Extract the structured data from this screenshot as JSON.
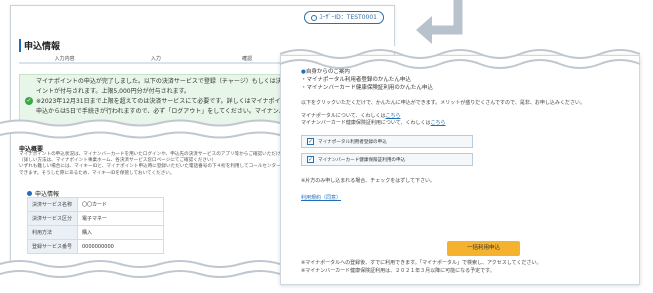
{
  "user_badge": {
    "text": "ﾕｰｻﾞｰID：TEST0001"
  },
  "left": {
    "title": "申込情報",
    "steps": [
      "入力内容",
      "入力",
      "確認",
      "完了"
    ],
    "notice_lines": [
      "マイナポイントの申込が完了しました。以下の決済サービスで登録（チャージ）もしくは決済購入お",
      "イントが付与されます。上限5,000円分が付与されます。",
      "※2023年12月31日まで上限を超えてのは決済サービスにて必要です。詳しくはマイナポイントホームページをご確認",
      "申込からは5日で手続きが行われますので、必ず「ログアウト」をしてください。マイナンバーカードの"
    ],
    "notice_link": "マイナポイントホームページ",
    "section_title": "申込概要",
    "section_text": [
      "マイナポイントの申込状況は、マイナンバーカードを用いたログインや、申込先の決済サービスのアプリ等からご確認いただけます。",
      "（詳しい方法は、マイナポイント事業ホーム、各決済サービス窓口ページにてご確認ください）",
      "いずれも難しい場合には、マイキーIDと、マイナポイント申込時に登録いただいた電話番号の下４桁を利用してコールセンターに",
      "できます。そうした際にあるため、マイキーIDを保管しておいてください。"
    ],
    "info_header": "申込情報",
    "table": [
      {
        "key": "決済サービス名称",
        "value": "〇〇カード"
      },
      {
        "key": "決済サービス区分",
        "value": "電子マネー"
      },
      {
        "key": "利用方法",
        "value": "購入"
      },
      {
        "key": "登録サービス番号",
        "value": "0000000000"
      }
    ]
  },
  "right": {
    "head_lines": [
      "自身からのご案内",
      "・マイナポータル利用者登録のかんたん申込",
      "・マイナンバーカード健康保険証利用のかんたん申込"
    ],
    "body1": "以下をクリックいただくだけで、かんたんに申込ができます。メリットが盛りだくさんですので、是非、お申し込みください。",
    "portal_link_line": "マイナポータルについて、くわしくは",
    "insurance_link_line": "マイナンバーカード健康保険証利用について、くわしくは",
    "link_here": "こちら",
    "checkbox1": "マイナポータル利用者登録の申込",
    "checkbox2": "マイナンバーカード健康保険証利用の申込",
    "note": "※片方のみ申し込まれる場合、チェックをはずして下さい。",
    "terms_link": "利用規約（同意）",
    "cta": "一括利用申込",
    "footer1": "※マイナポータルへの登録後、すでに利用できます。「マイナポータル」で検索し、アクセスしてください。",
    "footer2": "※マイナンバーカード健康保険証利用は、２０２１年３月以降に可能になる予定です。"
  }
}
